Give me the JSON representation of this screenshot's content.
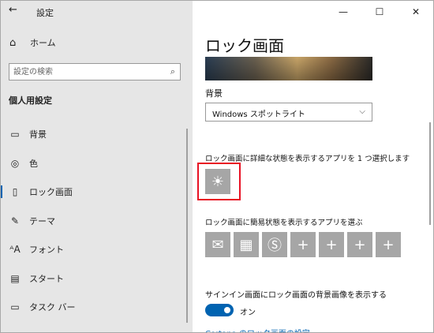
{
  "window": {
    "app_title": "設定",
    "back_icon": "back-arrow-icon",
    "minimize_icon": "minimize-icon",
    "maximize_icon": "maximize-icon",
    "close_icon": "close-icon"
  },
  "sidebar": {
    "home_label": "ホーム",
    "search_placeholder": "設定の検索",
    "section_title": "個人用設定",
    "items": [
      {
        "label": "背景",
        "icon": "image-icon",
        "selected": false
      },
      {
        "label": "色",
        "icon": "palette-icon",
        "selected": false
      },
      {
        "label": "ロック画面",
        "icon": "lock-screen-icon",
        "selected": true
      },
      {
        "label": "テーマ",
        "icon": "theme-brush-icon",
        "selected": false
      },
      {
        "label": "フォント",
        "icon": "font-icon",
        "selected": false
      },
      {
        "label": "スタート",
        "icon": "start-menu-icon",
        "selected": false
      },
      {
        "label": "タスク バー",
        "icon": "taskbar-icon",
        "selected": false
      }
    ]
  },
  "main": {
    "title": "ロック画面",
    "background_label": "背景",
    "background_value": "Windows スポットライト",
    "detail_status_label": "ロック画面に詳細な状態を表示するアプリを 1 つ選択します",
    "detail_app_icon": "weather-sun-icon",
    "quick_status_label": "ロック画面に簡易状態を表示するアプリを選ぶ",
    "quick_apps": [
      {
        "icon": "mail-icon"
      },
      {
        "icon": "calendar-icon"
      },
      {
        "icon": "skype-icon"
      },
      {
        "icon": "add-icon"
      },
      {
        "icon": "add-icon"
      },
      {
        "icon": "add-icon"
      },
      {
        "icon": "add-icon"
      }
    ],
    "signin_label": "サインイン画面にロック画面の背景画像を表示する",
    "toggle_state": "オン",
    "toggle_on": true,
    "cortana_link": "Cortana のロック画面の設定"
  },
  "colors": {
    "accent": "#0063b1",
    "highlight_border": "#e81123",
    "tile_gray": "#a6a6a6",
    "sidebar_bg": "#e6e6e6"
  }
}
